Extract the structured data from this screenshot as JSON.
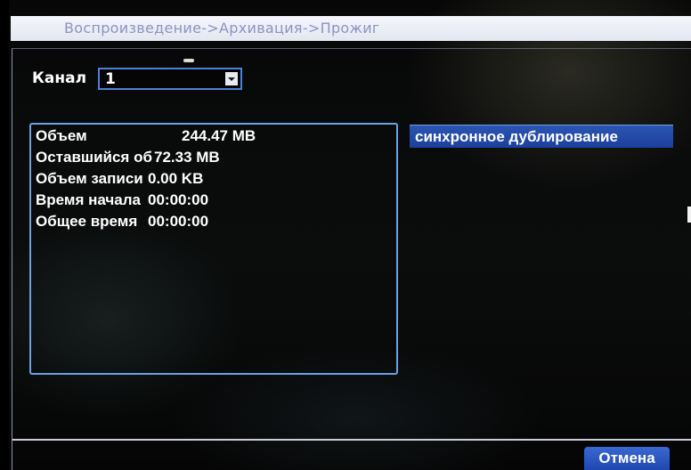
{
  "header": {
    "breadcrumb": "Воспроизведение->Архивация->Прожиг"
  },
  "channel": {
    "label": "Канал",
    "value": "1"
  },
  "info": {
    "rows": [
      {
        "label": "Объем",
        "value": "244.47 MB"
      },
      {
        "label": "Оставшийся об",
        "value": "72.33 MB"
      },
      {
        "label": "Объем записи",
        "value": "0.00 KB"
      },
      {
        "label": "Время начала",
        "value": "00:00:00"
      },
      {
        "label": "Общее время",
        "value": "00:00:00"
      }
    ]
  },
  "actions": {
    "sync_label": "синхронное дублирование",
    "cancel_label": "Отмена"
  },
  "icons": {
    "dropdown": "chevron-down-icon"
  },
  "colors": {
    "title_bar": "#e3e7f0",
    "title_text": "#8b93c4",
    "accent_blue": "#2b55b5",
    "box_border": "#6aa2e6",
    "select_border": "#4f7fd8"
  }
}
